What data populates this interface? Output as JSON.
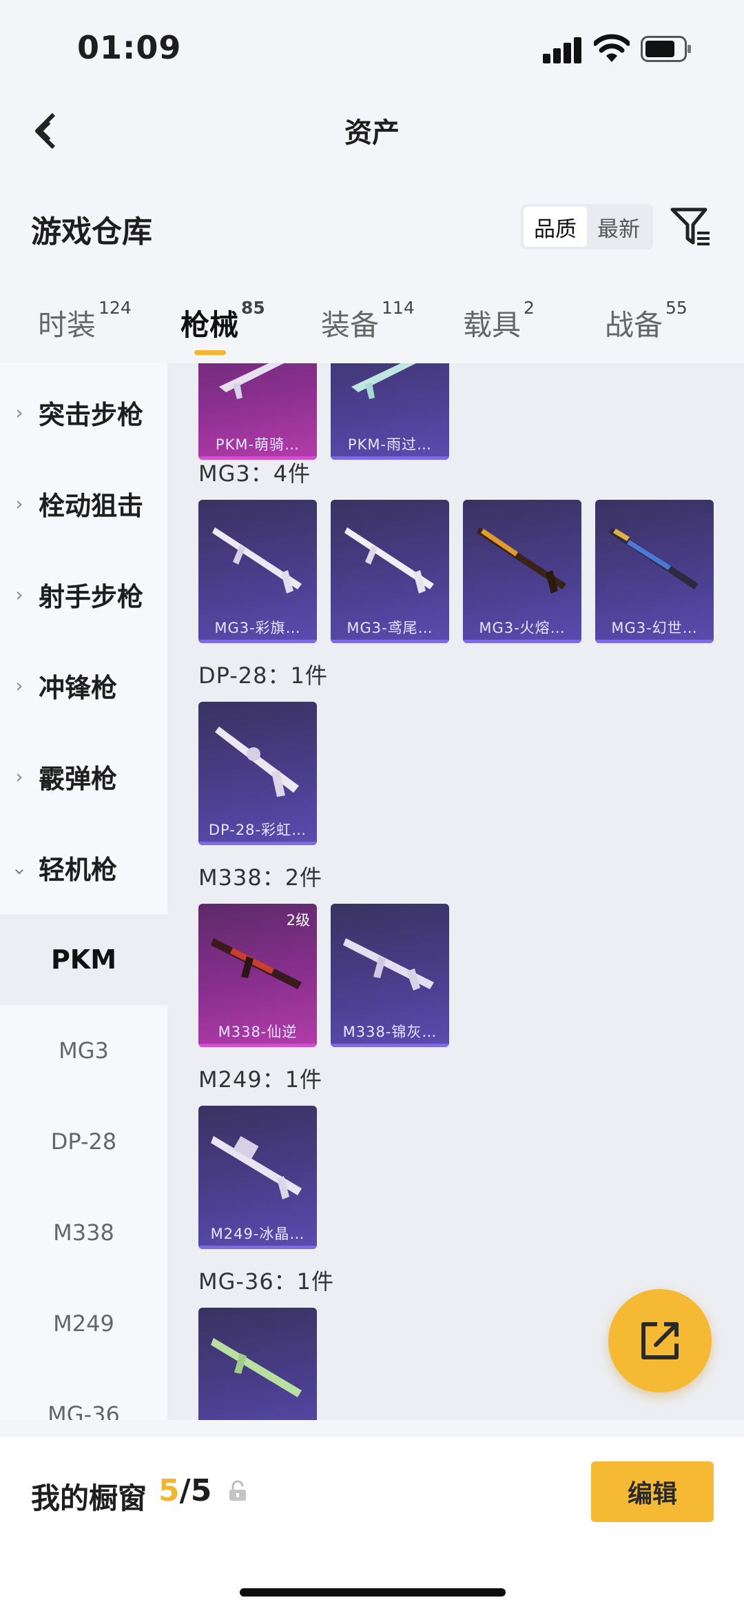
{
  "status": {
    "time": "01:09"
  },
  "nav": {
    "title": "资产"
  },
  "header": {
    "title": "游戏仓库",
    "sort_options": [
      "品质",
      "最新"
    ],
    "sort_selected": "品质"
  },
  "tabs": [
    {
      "label": "时装",
      "count": "124"
    },
    {
      "label": "枪械",
      "count": "85"
    },
    {
      "label": "装备",
      "count": "114"
    },
    {
      "label": "载具",
      "count": "2"
    },
    {
      "label": "战备",
      "count": "55"
    }
  ],
  "sidebar": {
    "categories": [
      "突击步枪",
      "栓动狙击",
      "射手步枪",
      "冲锋枪",
      "霰弹枪",
      "轻机枪"
    ],
    "subitems": [
      "PKM",
      "MG3",
      "DP-28",
      "M338",
      "M249",
      "MG-36"
    ],
    "active_sub": "PKM"
  },
  "groups": {
    "pkm": {
      "items": [
        {
          "name": "PKM-萌骑…",
          "rarity": "pink"
        },
        {
          "name": "PKM-雨过…",
          "rarity": "purple"
        }
      ]
    },
    "mg3": {
      "label": "MG3：4件",
      "items": [
        {
          "name": "MG3-彩旗…"
        },
        {
          "name": "MG3-鸢尾…"
        },
        {
          "name": "MG3-火熔…"
        },
        {
          "name": "MG3-幻世…"
        }
      ]
    },
    "dp28": {
      "label": "DP-28：1件",
      "items": [
        {
          "name": "DP-28-彩虹…"
        }
      ]
    },
    "m338": {
      "label": "M338：2件",
      "items": [
        {
          "name": "M338-仙逆",
          "level": "2级",
          "rarity": "pink"
        },
        {
          "name": "M338-锦灰…"
        }
      ]
    },
    "m249": {
      "label": "M249：1件",
      "items": [
        {
          "name": "M249-冰晶…"
        }
      ]
    },
    "mg36": {
      "label": "MG-36：1件"
    }
  },
  "bottom": {
    "window_label": "我的橱窗",
    "window_current": "5",
    "window_total": "/5",
    "edit_label": "编辑"
  },
  "colors": {
    "accent": "#f6b934",
    "card_purple": "#4a3e8c",
    "card_pink": "#8a2f90"
  },
  "icons": [
    "back-arrow-icon",
    "filter-icon",
    "chevron-right-icon",
    "chevron-down-icon",
    "share-icon",
    "lock-icon",
    "signal-icon",
    "wifi-icon",
    "battery-icon"
  ]
}
